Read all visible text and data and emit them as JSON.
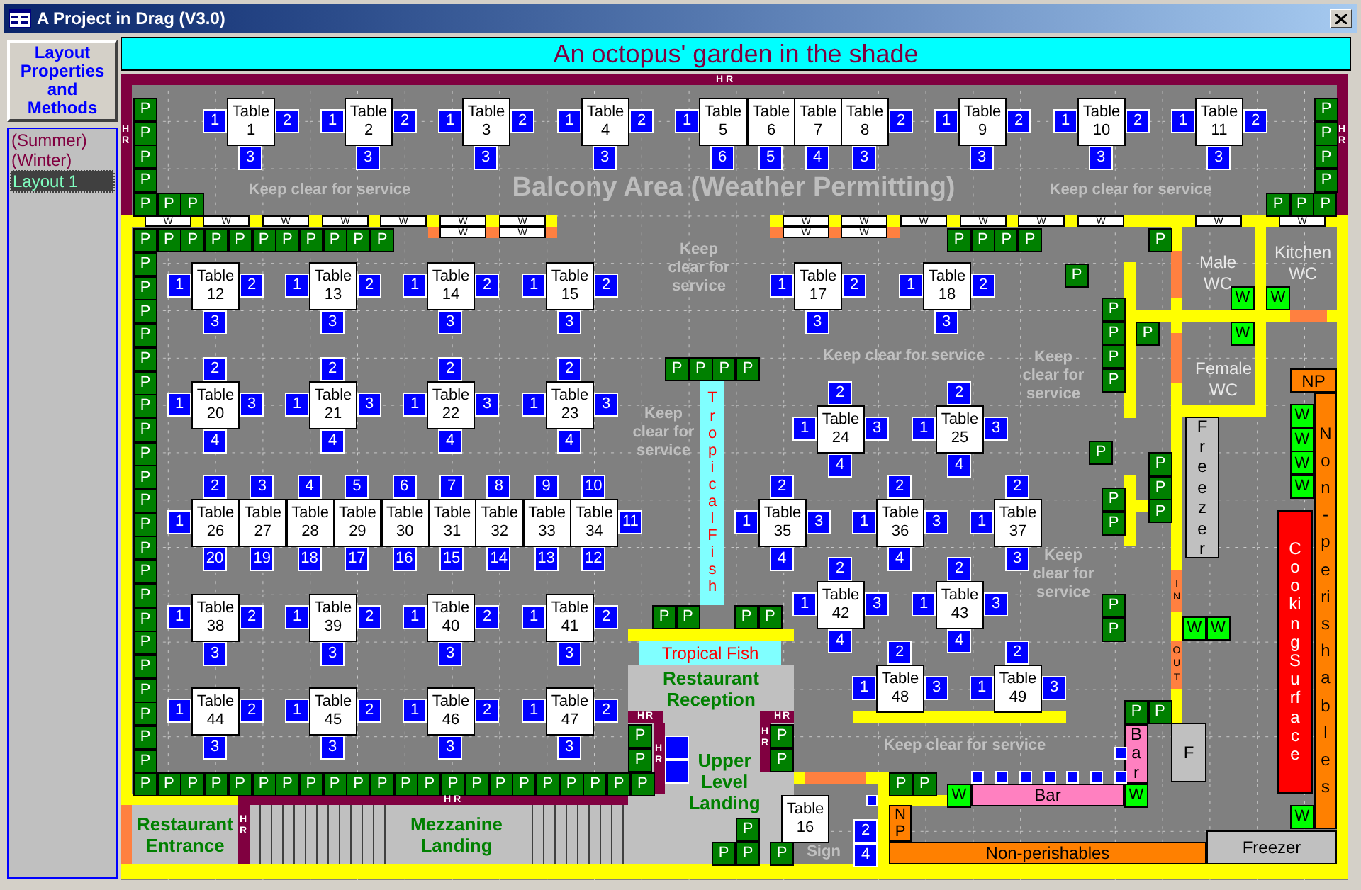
{
  "window": {
    "title": "A Project in Drag (V3.0)"
  },
  "sidebar": {
    "button": "Layout Properties and Methods",
    "layouts": [
      {
        "label": "(Summer)",
        "selected": false
      },
      {
        "label": "(Winter)",
        "selected": false
      },
      {
        "label": "Layout 1",
        "selected": true
      }
    ]
  },
  "banner": "An octopus' garden in the shade",
  "floor_plan": {
    "tables": [
      {
        "name": "Table",
        "number": "1",
        "seats": [
          {
            "label": "1",
            "kind": "left"
          },
          {
            "label": "2",
            "kind": "right"
          },
          {
            "label": "3",
            "kind": "bottom"
          }
        ]
      },
      {
        "name": "Table",
        "number": "2",
        "seats": [
          {
            "label": "1",
            "kind": "left"
          },
          {
            "label": "2",
            "kind": "right"
          },
          {
            "label": "3",
            "kind": "bottom"
          }
        ]
      },
      {
        "name": "Table",
        "number": "3",
        "seats": [
          {
            "label": "1",
            "kind": "left"
          },
          {
            "label": "2",
            "kind": "right"
          },
          {
            "label": "3",
            "kind": "bottom"
          }
        ]
      },
      {
        "name": "Table",
        "number": "4",
        "seats": [
          {
            "label": "1",
            "kind": "left"
          },
          {
            "label": "2",
            "kind": "right"
          },
          {
            "label": "3",
            "kind": "bottom"
          }
        ]
      },
      {
        "name": "Table",
        "number": "5",
        "seats": [
          {
            "label": "1",
            "kind": "left"
          },
          {
            "label": "6",
            "kind": "bottom"
          }
        ]
      },
      {
        "name": "Table",
        "number": "6",
        "seats": [
          {
            "label": "5",
            "kind": "bottom"
          }
        ]
      },
      {
        "name": "Table",
        "number": "7",
        "seats": [
          {
            "label": "4",
            "kind": "bottom"
          }
        ]
      },
      {
        "name": "Table",
        "number": "8",
        "seats": [
          {
            "label": "2",
            "kind": "right"
          },
          {
            "label": "3",
            "kind": "bottom"
          }
        ]
      },
      {
        "name": "Table",
        "number": "9",
        "seats": [
          {
            "label": "1",
            "kind": "left"
          },
          {
            "label": "2",
            "kind": "right"
          },
          {
            "label": "3",
            "kind": "bottom"
          }
        ]
      },
      {
        "name": "Table",
        "number": "10",
        "seats": [
          {
            "label": "1",
            "kind": "left"
          },
          {
            "label": "2",
            "kind": "right"
          },
          {
            "label": "3",
            "kind": "bottom"
          }
        ]
      },
      {
        "name": "Table",
        "number": "11",
        "seats": [
          {
            "label": "1",
            "kind": "left"
          },
          {
            "label": "2",
            "kind": "right"
          },
          {
            "label": "3",
            "kind": "bottom"
          }
        ]
      },
      {
        "name": "Table",
        "number": "12",
        "seats": [
          {
            "label": "1",
            "kind": "left"
          },
          {
            "label": "2",
            "kind": "right"
          },
          {
            "label": "3",
            "kind": "bottom"
          }
        ]
      },
      {
        "name": "Table",
        "number": "13",
        "seats": [
          {
            "label": "1",
            "kind": "left"
          },
          {
            "label": "2",
            "kind": "right"
          },
          {
            "label": "3",
            "kind": "bottom"
          }
        ]
      },
      {
        "name": "Table",
        "number": "14",
        "seats": [
          {
            "label": "1",
            "kind": "left"
          },
          {
            "label": "2",
            "kind": "right"
          },
          {
            "label": "3",
            "kind": "bottom"
          }
        ]
      },
      {
        "name": "Table",
        "number": "15",
        "seats": [
          {
            "label": "1",
            "kind": "left"
          },
          {
            "label": "2",
            "kind": "right"
          },
          {
            "label": "3",
            "kind": "bottom"
          }
        ]
      },
      {
        "name": "Table",
        "number": "17",
        "seats": [
          {
            "label": "1",
            "kind": "left"
          },
          {
            "label": "2",
            "kind": "right"
          },
          {
            "label": "3",
            "kind": "bottom"
          }
        ]
      },
      {
        "name": "Table",
        "number": "18",
        "seats": [
          {
            "label": "1",
            "kind": "left"
          },
          {
            "label": "2",
            "kind": "right"
          },
          {
            "label": "3",
            "kind": "bottom"
          }
        ]
      },
      {
        "name": "Table",
        "number": "20",
        "seats": [
          {
            "label": "2",
            "kind": "top"
          },
          {
            "label": "1",
            "kind": "left"
          },
          {
            "label": "3",
            "kind": "right"
          },
          {
            "label": "4",
            "kind": "bottom"
          }
        ]
      },
      {
        "name": "Table",
        "number": "21",
        "seats": [
          {
            "label": "2",
            "kind": "top"
          },
          {
            "label": "1",
            "kind": "left"
          },
          {
            "label": "3",
            "kind": "right"
          },
          {
            "label": "4",
            "kind": "bottom"
          }
        ]
      },
      {
        "name": "Table",
        "number": "22",
        "seats": [
          {
            "label": "2",
            "kind": "top"
          },
          {
            "label": "1",
            "kind": "left"
          },
          {
            "label": "3",
            "kind": "right"
          },
          {
            "label": "4",
            "kind": "bottom"
          }
        ]
      },
      {
        "name": "Table",
        "number": "23",
        "seats": [
          {
            "label": "2",
            "kind": "top"
          },
          {
            "label": "1",
            "kind": "left"
          },
          {
            "label": "3",
            "kind": "right"
          },
          {
            "label": "4",
            "kind": "bottom"
          }
        ]
      },
      {
        "name": "Table",
        "number": "24",
        "seats": [
          {
            "label": "2",
            "kind": "top"
          },
          {
            "label": "1",
            "kind": "left"
          },
          {
            "label": "3",
            "kind": "right"
          },
          {
            "label": "4",
            "kind": "bottom"
          }
        ]
      },
      {
        "name": "Table",
        "number": "25",
        "seats": [
          {
            "label": "2",
            "kind": "top"
          },
          {
            "label": "1",
            "kind": "left"
          },
          {
            "label": "3",
            "kind": "right"
          },
          {
            "label": "4",
            "kind": "bottom"
          }
        ]
      },
      {
        "name": "Table",
        "number": "26",
        "seats": [
          {
            "label": "2",
            "kind": "top"
          },
          {
            "label": "1",
            "kind": "left"
          },
          {
            "label": "20",
            "kind": "bottom"
          }
        ]
      },
      {
        "name": "Table",
        "number": "27",
        "seats": [
          {
            "label": "3",
            "kind": "top"
          },
          {
            "label": "19",
            "kind": "bottom"
          }
        ]
      },
      {
        "name": "Table",
        "number": "28",
        "seats": [
          {
            "label": "4",
            "kind": "top"
          },
          {
            "label": "18",
            "kind": "bottom"
          }
        ]
      },
      {
        "name": "Table",
        "number": "29",
        "seats": [
          {
            "label": "5",
            "kind": "top"
          },
          {
            "label": "17",
            "kind": "bottom"
          }
        ]
      },
      {
        "name": "Table",
        "number": "30",
        "seats": [
          {
            "label": "6",
            "kind": "top"
          },
          {
            "label": "16",
            "kind": "bottom"
          }
        ]
      },
      {
        "name": "Table",
        "number": "31",
        "seats": [
          {
            "label": "7",
            "kind": "top"
          },
          {
            "label": "15",
            "kind": "bottom"
          }
        ]
      },
      {
        "name": "Table",
        "number": "32",
        "seats": [
          {
            "label": "8",
            "kind": "top"
          },
          {
            "label": "14",
            "kind": "bottom"
          }
        ]
      },
      {
        "name": "Table",
        "number": "33",
        "seats": [
          {
            "label": "9",
            "kind": "top"
          },
          {
            "label": "13",
            "kind": "bottom"
          }
        ]
      },
      {
        "name": "Table",
        "number": "34",
        "seats": [
          {
            "label": "10",
            "kind": "top"
          },
          {
            "label": "11",
            "kind": "right"
          },
          {
            "label": "12",
            "kind": "bottom"
          }
        ]
      },
      {
        "name": "Table",
        "number": "35",
        "seats": [
          {
            "label": "2",
            "kind": "top"
          },
          {
            "label": "1",
            "kind": "left"
          },
          {
            "label": "3",
            "kind": "right"
          },
          {
            "label": "4",
            "kind": "bottom"
          }
        ]
      },
      {
        "name": "Table",
        "number": "36",
        "seats": [
          {
            "label": "2",
            "kind": "top"
          },
          {
            "label": "1",
            "kind": "left"
          },
          {
            "label": "3",
            "kind": "right"
          },
          {
            "label": "4",
            "kind": "bottom"
          }
        ]
      },
      {
        "name": "Table",
        "number": "37",
        "seats": [
          {
            "label": "2",
            "kind": "top"
          },
          {
            "label": "1",
            "kind": "left"
          },
          {
            "label": "3",
            "kind": "bottom"
          }
        ]
      },
      {
        "name": "Table",
        "number": "42",
        "seats": [
          {
            "label": "2",
            "kind": "top"
          },
          {
            "label": "1",
            "kind": "left"
          },
          {
            "label": "3",
            "kind": "right"
          },
          {
            "label": "4",
            "kind": "bottom"
          }
        ]
      },
      {
        "name": "Table",
        "number": "43",
        "seats": [
          {
            "label": "2",
            "kind": "top"
          },
          {
            "label": "1",
            "kind": "left"
          },
          {
            "label": "3",
            "kind": "right"
          },
          {
            "label": "4",
            "kind": "bottom"
          }
        ]
      },
      {
        "name": "Table",
        "number": "38",
        "seats": [
          {
            "label": "1",
            "kind": "left"
          },
          {
            "label": "2",
            "kind": "right"
          },
          {
            "label": "3",
            "kind": "bottom"
          }
        ]
      },
      {
        "name": "Table",
        "number": "39",
        "seats": [
          {
            "label": "1",
            "kind": "left"
          },
          {
            "label": "2",
            "kind": "right"
          },
          {
            "label": "3",
            "kind": "bottom"
          }
        ]
      },
      {
        "name": "Table",
        "number": "40",
        "seats": [
          {
            "label": "1",
            "kind": "left"
          },
          {
            "label": "2",
            "kind": "right"
          },
          {
            "label": "3",
            "kind": "bottom"
          }
        ]
      },
      {
        "name": "Table",
        "number": "41",
        "seats": [
          {
            "label": "1",
            "kind": "left"
          },
          {
            "label": "2",
            "kind": "right"
          },
          {
            "label": "3",
            "kind": "bottom"
          }
        ]
      },
      {
        "name": "Table",
        "number": "48",
        "seats": [
          {
            "label": "2",
            "kind": "top"
          },
          {
            "label": "1",
            "kind": "left"
          },
          {
            "label": "3",
            "kind": "right"
          }
        ]
      },
      {
        "name": "Table",
        "number": "49",
        "seats": [
          {
            "label": "2",
            "kind": "top"
          },
          {
            "label": "1",
            "kind": "left"
          },
          {
            "label": "3",
            "kind": "right"
          }
        ]
      },
      {
        "name": "Table",
        "number": "44",
        "seats": [
          {
            "label": "1",
            "kind": "left"
          },
          {
            "label": "2",
            "kind": "right"
          },
          {
            "label": "3",
            "kind": "bottom"
          }
        ]
      },
      {
        "name": "Table",
        "number": "45",
        "seats": [
          {
            "label": "1",
            "kind": "left"
          },
          {
            "label": "2",
            "kind": "right"
          },
          {
            "label": "3",
            "kind": "bottom"
          }
        ]
      },
      {
        "name": "Table",
        "number": "46",
        "seats": [
          {
            "label": "1",
            "kind": "left"
          },
          {
            "label": "2",
            "kind": "right"
          },
          {
            "label": "3",
            "kind": "bottom"
          }
        ]
      },
      {
        "name": "Table",
        "number": "47",
        "seats": [
          {
            "label": "1",
            "kind": "left"
          },
          {
            "label": "2",
            "kind": "right"
          },
          {
            "label": "3",
            "kind": "bottom"
          }
        ]
      },
      {
        "name": "Table",
        "number": "16",
        "seats": [
          {
            "label": "2",
            "kind": "outer-upper"
          },
          {
            "label": "4",
            "kind": "outer-lower"
          }
        ]
      }
    ],
    "planters": [
      {
        "cells": [
          "P",
          "P",
          "P",
          "P"
        ]
      },
      {
        "cells": [
          "P",
          "P",
          "P"
        ]
      },
      {
        "cells": [
          "P",
          "P",
          "P",
          "P"
        ]
      },
      {
        "cells": [
          "P",
          "P",
          "P"
        ]
      },
      {
        "cells": [
          "P",
          "P",
          "P",
          "P",
          "P",
          "P",
          "P",
          "P",
          "P",
          "P",
          "P"
        ]
      },
      {
        "cells": [
          "P",
          "P",
          "P",
          "P",
          "P",
          "P",
          "P",
          "P",
          "P",
          "P",
          "P",
          "P",
          "P",
          "P",
          "P",
          "P",
          "P",
          "P",
          "P",
          "P",
          "P",
          "P"
        ]
      },
      {
        "cells": [
          "P",
          "P",
          "P",
          "P",
          "P",
          "P",
          "P",
          "P",
          "P",
          "P",
          "P",
          "P",
          "P",
          "P",
          "P",
          "P",
          "P",
          "P",
          "P",
          "P",
          "P",
          "P"
        ]
      },
      {
        "cells": [
          "P",
          "P",
          "P",
          "P"
        ]
      },
      {
        "cells": [
          "P"
        ]
      },
      {
        "cells": [
          "P"
        ]
      },
      {
        "cells": [
          "P",
          "P",
          "P",
          "P"
        ]
      },
      {
        "cells": [
          "P"
        ]
      },
      {
        "cells": [
          "P",
          "P",
          "P",
          "P"
        ]
      },
      {
        "cells": [
          "P"
        ]
      },
      {
        "cells": [
          "P",
          "P",
          "P"
        ]
      },
      {
        "cells": [
          "P",
          "P"
        ]
      },
      {
        "cells": [
          "P",
          "P"
        ]
      },
      {
        "cells": [
          "P",
          "P"
        ]
      },
      {
        "cells": [
          "P",
          "P"
        ]
      },
      {
        "cells": [
          "P",
          "P"
        ]
      },
      {
        "cells": [
          "P",
          "P"
        ]
      },
      {
        "cells": [
          "P",
          "P"
        ]
      },
      {
        "cells": [
          "P"
        ]
      },
      {
        "cells": [
          "P",
          "P"
        ]
      },
      {
        "cells": [
          "P"
        ]
      },
      {
        "cells": [
          "P",
          "P"
        ]
      }
    ],
    "rails": [
      {
        "cells": [
          "W",
          "W",
          "W",
          "W",
          "W",
          "W",
          "W"
        ]
      },
      {
        "cells": [
          "W",
          "W"
        ]
      },
      {
        "cells": [
          "W",
          "W",
          "W",
          "W",
          "W",
          "W",
          "W",
          "W"
        ]
      },
      {
        "cells": [
          "W",
          "W"
        ]
      }
    ],
    "wash_units": [
      {
        "cells": [
          "W"
        ]
      },
      {
        "cells": [
          "W"
        ]
      },
      {
        "cells": [
          "W"
        ]
      },
      {
        "cells": [
          "W",
          "W",
          "W",
          "W"
        ]
      },
      {
        "cells": [
          "W",
          "W"
        ]
      },
      {
        "cells": [
          "W"
        ]
      },
      {
        "cells": [
          "W"
        ]
      },
      {
        "cells": [
          "W"
        ]
      }
    ],
    "hr_tags": [
      "HR",
      "HR",
      "HR",
      "HR",
      "HR",
      "HR",
      "HR",
      "HR",
      "HR"
    ],
    "notes": [
      "Keep clear for service",
      "Balcony Area (Weather Permitting)",
      "Keep clear for service",
      "Keep clear for service",
      "Keep clear for service",
      "Keep clear for service",
      "Keep clear for service",
      "Keep clear for service",
      "Keep clear for service",
      "Sign"
    ],
    "fixtures": [
      {
        "label": "Tropical Fish",
        "kind": "aquarium"
      },
      {
        "label": "Tropical Fish",
        "kind": "aquarium"
      },
      {
        "label": "Restaurant Reception",
        "kind": "room"
      },
      {
        "label": "Upper Level Landing",
        "kind": "label"
      },
      {
        "label": "Restaurant Entrance",
        "kind": "room"
      },
      {
        "label": "Mezzanine Landing",
        "kind": "room"
      },
      {
        "label": "Male WC",
        "kind": "wc"
      },
      {
        "label": "Kitchen WC",
        "kind": "wc"
      },
      {
        "label": "Female WC",
        "kind": "wc"
      },
      {
        "label": "Freezer",
        "kind": "freezer"
      },
      {
        "label": "NP",
        "kind": "storage"
      },
      {
        "label": "Cooking Surface",
        "kind": "cooker"
      },
      {
        "label": "Non-perishables",
        "kind": "storage"
      },
      {
        "label": "IN",
        "kind": "door"
      },
      {
        "label": "OUT",
        "kind": "door"
      },
      {
        "label": "Bar",
        "kind": "bar"
      },
      {
        "label": "F",
        "kind": "freezer"
      },
      {
        "label": "Bar",
        "kind": "bar"
      },
      {
        "label": "NP",
        "kind": "storage"
      },
      {
        "label": "Non-perishables",
        "kind": "storage"
      },
      {
        "label": "Freezer",
        "kind": "freezer"
      }
    ]
  }
}
